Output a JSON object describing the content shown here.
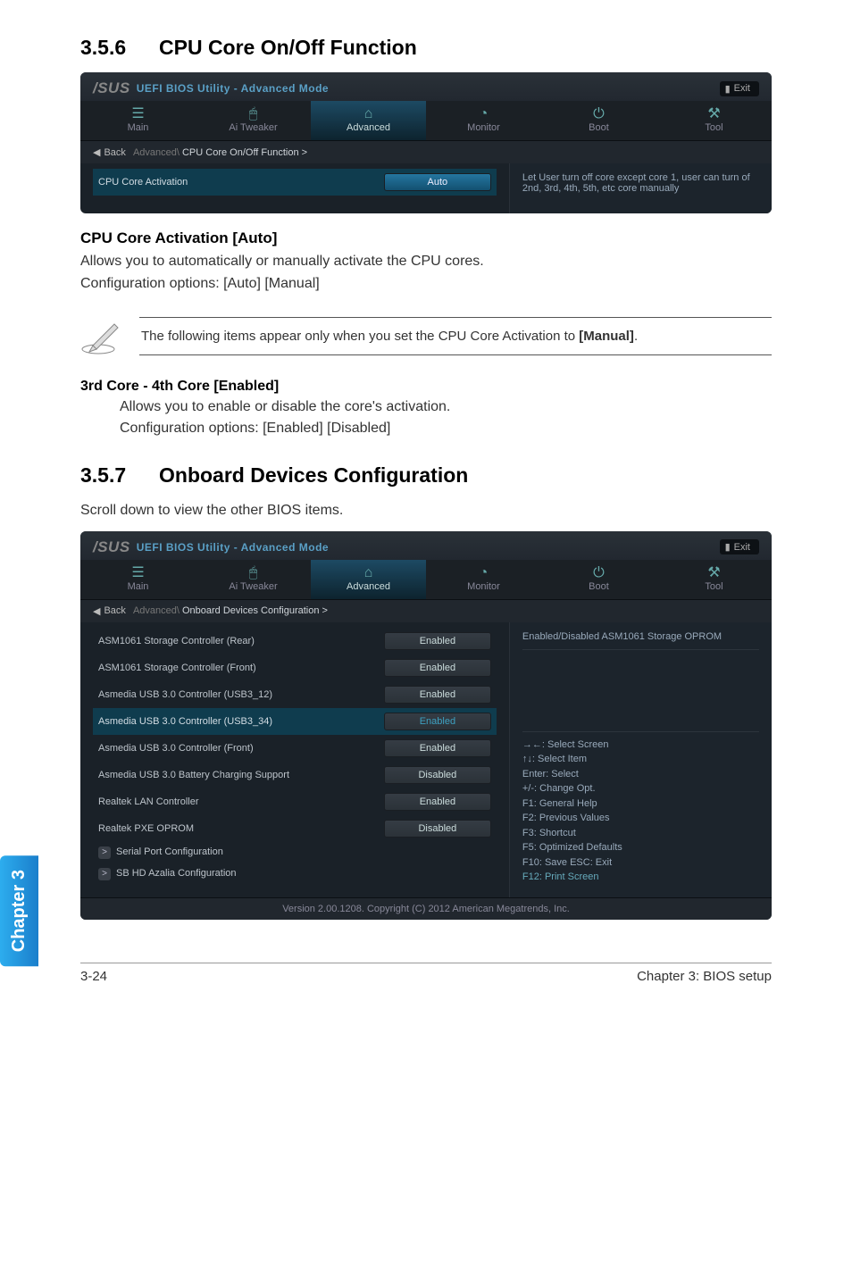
{
  "section1": {
    "number": "3.5.6",
    "title": "CPU Core On/Off Function"
  },
  "bios1": {
    "brand": "UEFI BIOS Utility - Advanced Mode",
    "exit": "Exit",
    "tabs": {
      "main": "Main",
      "ai": "Ai Tweaker",
      "adv": "Advanced",
      "mon": "Monitor",
      "boot": "Boot",
      "tool": "Tool"
    },
    "back": "Back",
    "bc_dim": "Advanced\\",
    "bc_light": "CPU Core On/Off Function  >",
    "row_label": "CPU Core Activation",
    "row_val": "Auto",
    "help": "Let User turn off core except core 1, user can turn of 2nd, 3rd, 4th, 5th, etc core manually"
  },
  "sub1": {
    "heading": "CPU Core Activation [Auto]",
    "p1": "Allows you to automatically or manually activate the CPU cores.",
    "p2": "Configuration options: [Auto] [Manual]"
  },
  "note1": "The following items appear only when you set the CPU Core Activation to [Manual].",
  "opt1": {
    "heading": "3rd Core - 4th Core [Enabled]",
    "l1": "Allows you to enable or disable the core's activation.",
    "l2": "Configuration options: [Enabled] [Disabled]"
  },
  "section2": {
    "number": "3.5.7",
    "title": "Onboard Devices Configuration",
    "desc": "Scroll down to view the other BIOS items."
  },
  "bios2": {
    "brand": "UEFI BIOS Utility - Advanced Mode",
    "exit": "Exit",
    "back": "Back",
    "bc_dim": "Advanced\\",
    "bc_light": "Onboard Devices Configuration  >",
    "rows": [
      {
        "label": "ASM1061 Storage Controller (Rear)",
        "val": "Enabled",
        "sel": false
      },
      {
        "label": "ASM1061 Storage Controller (Front)",
        "val": "Enabled",
        "sel": false
      },
      {
        "label": "Asmedia USB 3.0 Controller (USB3_12)",
        "val": "Enabled",
        "sel": false
      },
      {
        "label": "Asmedia USB 3.0 Controller (USB3_34)",
        "val": "Enabled",
        "sel": true
      },
      {
        "label": "Asmedia USB 3.0 Controller (Front)",
        "val": "Enabled",
        "sel": false
      },
      {
        "label": "Asmedia USB 3.0 Battery Charging Support",
        "val": "Disabled",
        "sel": false
      },
      {
        "label": "Realtek LAN Controller",
        "val": "Enabled",
        "sel": false
      },
      {
        "label": "Realtek PXE OPROM",
        "val": "Disabled",
        "sel": false
      }
    ],
    "nav1": "Serial Port Configuration",
    "nav2": "SB HD Azalia Configuration",
    "help_top": "Enabled/Disabled ASM1061 Storage OPROM",
    "keys": [
      "→←:  Select Screen",
      "↑↓:  Select Item",
      "Enter:  Select",
      "+/-:  Change Opt.",
      "F1:  General Help",
      "F2:  Previous Values",
      "F3:  Shortcut",
      "F5:  Optimized Defaults",
      "F10:  Save   ESC:  Exit"
    ],
    "key_print": "F12: Print Screen",
    "version": "Version 2.00.1208.  Copyright (C) 2012 American Megatrends, Inc."
  },
  "chapter_tab": "Chapter 3",
  "footer": {
    "left": "3-24",
    "right": "Chapter 3: BIOS setup"
  }
}
